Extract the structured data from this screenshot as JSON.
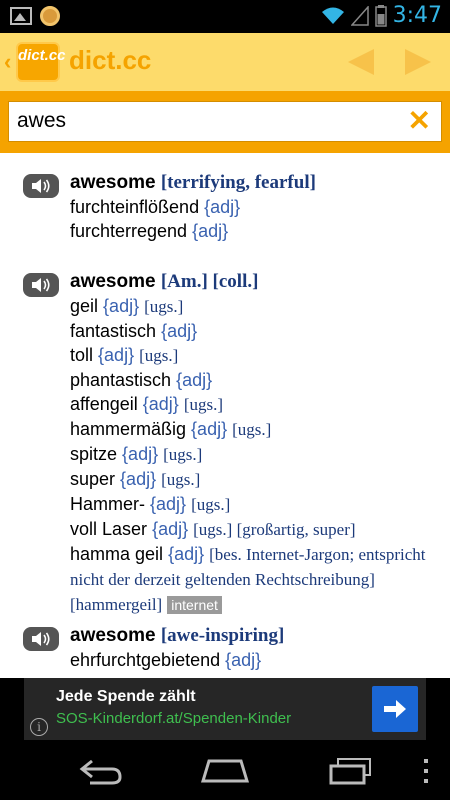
{
  "status_bar": {
    "time": "3:47"
  },
  "app": {
    "logo_text": "dict.cc",
    "title": "dict.cc"
  },
  "search": {
    "value": "awes",
    "clear_symbol": "✕"
  },
  "entries": [
    {
      "headword": "awesome",
      "label": "[terrifying, fearful]",
      "translations": [
        {
          "word": "furchteinflößend",
          "pos": "{adj}"
        },
        {
          "word": "furchterregend",
          "pos": "{adj}"
        }
      ]
    },
    {
      "headword": "awesome",
      "label": "[Am.] [coll.]",
      "translations": [
        {
          "word": "geil",
          "pos": "{adj}",
          "note": "[ugs.]"
        },
        {
          "word": "fantastisch",
          "pos": "{adj}"
        },
        {
          "word": "toll",
          "pos": "{adj}",
          "note": "[ugs.]"
        },
        {
          "word": "phantastisch",
          "pos": "{adj}"
        },
        {
          "word": "affengeil",
          "pos": "{adj}",
          "note": "[ugs.]"
        },
        {
          "word": "hammermäßig",
          "pos": "{adj}",
          "note": "[ugs.]"
        },
        {
          "word": "spitze",
          "pos": "{adj}",
          "note": "[ugs.]"
        },
        {
          "word": "super",
          "pos": "{adj}",
          "note": "[ugs.]"
        },
        {
          "word": "Hammer-",
          "pos": "{adj}",
          "note": "[ugs.]"
        },
        {
          "word": "voll Laser",
          "pos": "{adj}",
          "note": "[ugs.] [großartig, super]"
        },
        {
          "word": "hamma geil",
          "pos": "{adj}",
          "note": "[bes. Internet-Jargon; entspricht nicht der derzeit geltenden Rechtschreibung] [hammergeil]",
          "tag": "internet"
        }
      ]
    },
    {
      "headword": "awesome",
      "label": "[awe-inspiring]",
      "translations": [
        {
          "word": "ehrfurchtgebietend",
          "pos": "{adj}"
        }
      ]
    }
  ],
  "ad": {
    "title": "Jede Spende zählt",
    "url": "SOS-Kinderdorf.at/Spenden-Kinder",
    "info_symbol": "i",
    "button_color": "#1a66d4"
  },
  "icons": {
    "status": [
      "gallery-icon",
      "notification-icon",
      "wifi-icon",
      "signal-icon",
      "battery-icon"
    ],
    "nav": [
      "back-nav-icon",
      "home-nav-icon",
      "recent-apps-icon",
      "overflow-menu-icon"
    ]
  },
  "colors": {
    "accent": "#f5a300",
    "header": "#fddb6b",
    "bracket": "#1c3a7a",
    "pos": "#3a62b0",
    "ad_url": "#3fbf4f"
  }
}
